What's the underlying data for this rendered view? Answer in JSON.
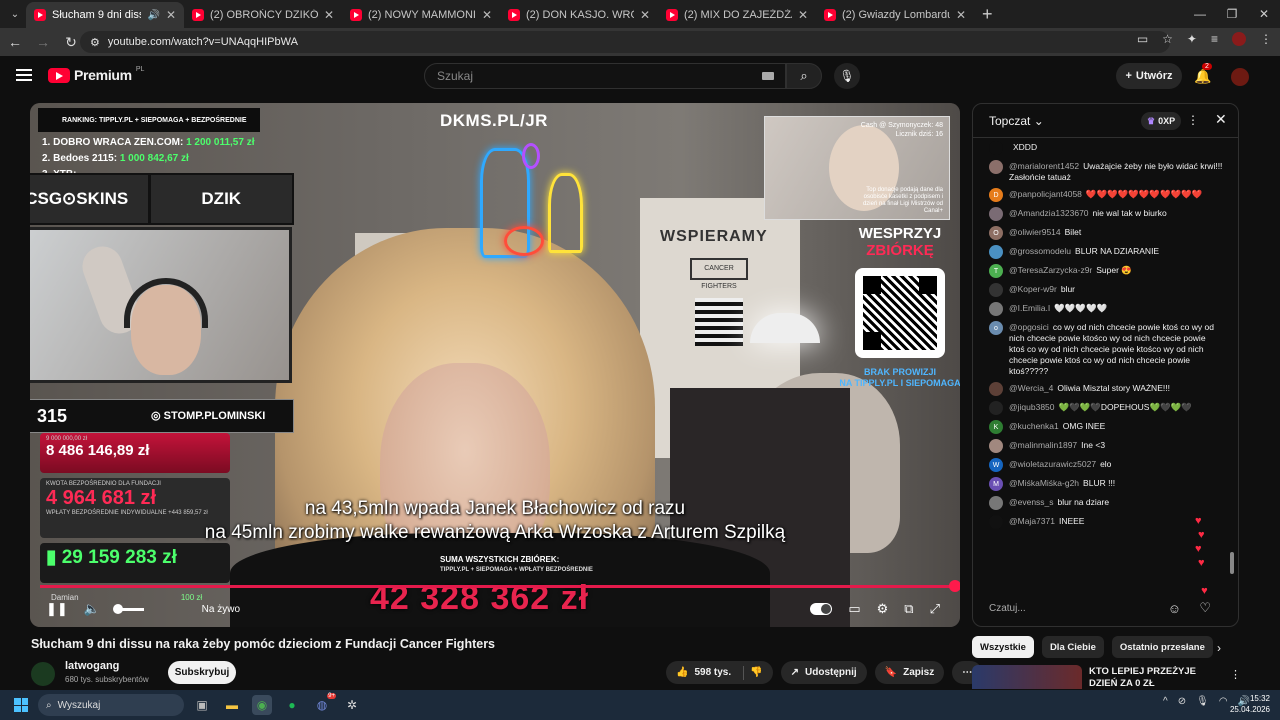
{
  "browser": {
    "tabs": [
      {
        "title": "Słucham 9 dni dissu na raka żeby",
        "active": true
      },
      {
        "title": "(2) OBROŃCY DZIKÓW pod Ratu",
        "active": false
      },
      {
        "title": "(2) NOWY MAMMONIK (v60.0)",
        "active": false
      },
      {
        "title": "(2) DON KASJO. WRÓCIŁ, BY NA",
        "active": false
      },
      {
        "title": "(2) MIX DO ZAJEŻDŻANIA NA K",
        "active": false
      },
      {
        "title": "(2) Gwiazdy Lombardu: Q&A Pyt",
        "active": false
      }
    ],
    "url": "youtube.com/watch?v=UNAqqHIPbWA"
  },
  "youtube": {
    "logo_text": "Premium",
    "logo_region": "PL",
    "search_placeholder": "Szukaj",
    "create_label": "Utwórz",
    "notif_count": "2"
  },
  "video": {
    "overlay": {
      "dkms": "DKMS.PL/JR",
      "ranking": "RANKING:  TIPPLY.PL + SIEPOMAGA + BEZPOŚREDNIE",
      "rank_items": [
        {
          "name": "1. DOBRO WRACA ZEN.COM:",
          "value": "1 200 011,57 zł"
        },
        {
          "name": "2. Bedoes 2115:",
          "value": "1 000 842,67 zł"
        },
        {
          "name": "3. XTB:",
          "value": ""
        }
      ],
      "sponsor_left": "CSG⊙SKINS",
      "sponsor_right": "DZIK",
      "viewers": "315",
      "instagram": "STOMP.PLOMINSKI",
      "cam_top": "Cash @ Szymonyczek: 48\nLicznik dziś: 16",
      "cam_bottom": "Top donacje podają dane dla osobisće kasetki z podpisem i dzień na finał Ligi Mistrzów od Canal+",
      "wesprzyj_1": "WESPRZYJ",
      "wesprzyj_2": "ZBIÓRKĘ",
      "brak_1": "BRAK PROWIZJI",
      "brak_2": "NA TIPPLY.PL I SIEPOMAGA",
      "donation_1_label": "9 000 000,00 zł",
      "donation_1_value": "8 486 146,89 zł",
      "donation_2_label": "KWOTA BEZPOŚREDNIO DLA FUNDACJI",
      "donation_2_value": "4 964 681 zł",
      "donation_2_sub": "WPŁATY BEZPOŚREDNIE INDYWIDUALNE  +443 859,57 zł",
      "donation_3_value": "29 159 283 zł",
      "suma_label": "SUMA WSZYSTKICH ZBIÓREK:",
      "suma_sub": "TIPPLY.PL + SIEPOMAGA + WPŁATY BEZPOŚREDNIE",
      "suma_value": "42 328 362 zł",
      "damian": "Damian",
      "damian_value": "100 zł"
    },
    "subtitle_1": "na 43,5mln wpada Janek Błachowicz od razu",
    "subtitle_2": "na 45mln zrobimy walke rewanżową  Arka Wrzoska z Arturem Szpilką",
    "live_label": "Na żywo",
    "wall_text": "WSPIERAMY",
    "cancer_text": "CANCER FIGHTERS"
  },
  "meta": {
    "title": "Słucham 9 dni dissu na raka żeby pomóc dzieciom z Fundacji Cancer Fighters",
    "channel": "latwogang",
    "subscribers": "680 tys. subskrybentów",
    "subscribe_label": "Subskrybuj",
    "likes": "598 tys.",
    "share_label": "Udostępnij",
    "save_label": "Zapisz"
  },
  "chat": {
    "mode": "Topczat",
    "xp": "0XP",
    "input_placeholder": "Czatuj...",
    "messages": [
      {
        "author": "",
        "text": "XDDD",
        "color": "#0f0f0f",
        "initial": ""
      },
      {
        "author": "@marialorent1452",
        "text": "Uważajcie żeby nie było widać krwi!!! Zasłońcie tatuaż",
        "color": "#8b6f6a",
        "initial": ""
      },
      {
        "author": "@panpolicjant4058",
        "text": "❤️❤️❤️❤️❤️❤️❤️❤️❤️❤️❤️",
        "color": "#e67c1b",
        "initial": "D"
      },
      {
        "author": "@Amandzia1323670",
        "text": "nie wal tak w biurko",
        "color": "#7a6b74",
        "initial": ""
      },
      {
        "author": "@oliwier9514",
        "text": "Bilet",
        "color": "#8d6e63",
        "initial": "O"
      },
      {
        "author": "@grossomodelu",
        "text": "BLUR NA DZIARANIE",
        "color": "#4a90c2",
        "initial": ""
      },
      {
        "author": "@TeresaZarzycka-z9r",
        "text": "Super 😍",
        "color": "#4caf50",
        "initial": "T"
      },
      {
        "author": "@Koper-w9r",
        "text": "blur",
        "color": "#333",
        "initial": ""
      },
      {
        "author": "@I.Emilia.I",
        "text": "🤍🤍🤍🤍🤍",
        "color": "#777",
        "initial": ""
      },
      {
        "author": "@opgosici",
        "text": "co wy od nich chcecie powie ktoś co wy od nich chcecie powie ktośco wy od nich chcecie powie ktoś co wy od nich chcecie powie ktośco wy od nich chcecie powie ktoś co wy od nich chcecie powie ktoś?????",
        "color": "#6a8caf",
        "initial": "o"
      },
      {
        "author": "@Wercia_4",
        "text": "Oliwia Misztal story WAŻNE!!!",
        "color": "#5d4037",
        "initial": ""
      },
      {
        "author": "@jiqub3850",
        "text": "💚🖤💚🖤DOPEHOUS💚🖤💚🖤",
        "color": "#222",
        "initial": ""
      },
      {
        "author": "@kuchenka1",
        "text": "OMG INEE",
        "color": "#2e7d32",
        "initial": "K"
      },
      {
        "author": "@malinmalin1897",
        "text": "Ine <3",
        "color": "#a1887f",
        "initial": ""
      },
      {
        "author": "@wioletazurawicz5027",
        "text": "elo",
        "color": "#1565c0",
        "initial": "W"
      },
      {
        "author": "@MiśkaMiśka-g2h",
        "text": "BLUR !!!",
        "color": "#6a4fb3",
        "initial": "M"
      },
      {
        "author": "@evenss_s",
        "text": "blur na dziare",
        "color": "#777",
        "initial": ""
      },
      {
        "author": "@Maja7371",
        "text": "INEEE",
        "color": "#111",
        "initial": ""
      }
    ]
  },
  "related": {
    "chips": [
      "Wszystkie",
      "Dla Ciebie",
      "Ostatnio przesłane"
    ],
    "first_title": "KTO LEPIEJ PRZEŻYJE DZIEŃ ZA 0 ZŁ"
  },
  "taskbar": {
    "search": "Wyszukaj",
    "time": "15:32",
    "date": "25.04.2026",
    "discord_badge": "9+"
  }
}
